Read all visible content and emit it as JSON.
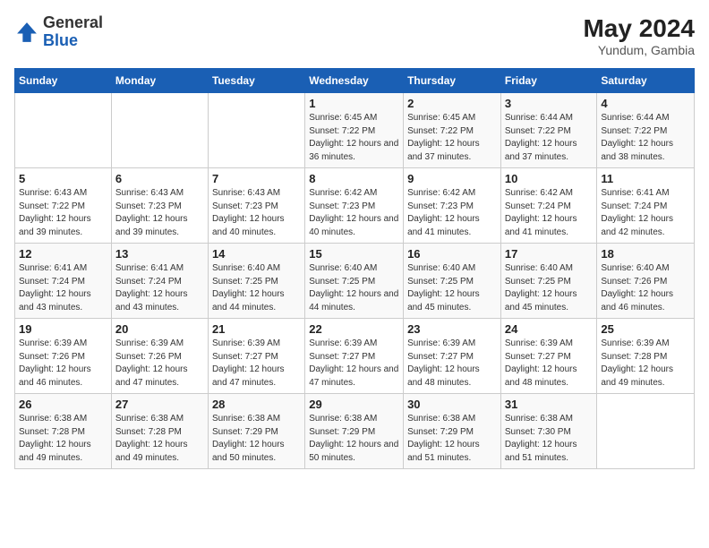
{
  "header": {
    "logo_general": "General",
    "logo_blue": "Blue",
    "month_year": "May 2024",
    "location": "Yundum, Gambia"
  },
  "weekdays": [
    "Sunday",
    "Monday",
    "Tuesday",
    "Wednesday",
    "Thursday",
    "Friday",
    "Saturday"
  ],
  "weeks": [
    [
      {
        "day": "",
        "sunrise": "",
        "sunset": "",
        "daylight": ""
      },
      {
        "day": "",
        "sunrise": "",
        "sunset": "",
        "daylight": ""
      },
      {
        "day": "",
        "sunrise": "",
        "sunset": "",
        "daylight": ""
      },
      {
        "day": "1",
        "sunrise": "Sunrise: 6:45 AM",
        "sunset": "Sunset: 7:22 PM",
        "daylight": "Daylight: 12 hours and 36 minutes."
      },
      {
        "day": "2",
        "sunrise": "Sunrise: 6:45 AM",
        "sunset": "Sunset: 7:22 PM",
        "daylight": "Daylight: 12 hours and 37 minutes."
      },
      {
        "day": "3",
        "sunrise": "Sunrise: 6:44 AM",
        "sunset": "Sunset: 7:22 PM",
        "daylight": "Daylight: 12 hours and 37 minutes."
      },
      {
        "day": "4",
        "sunrise": "Sunrise: 6:44 AM",
        "sunset": "Sunset: 7:22 PM",
        "daylight": "Daylight: 12 hours and 38 minutes."
      }
    ],
    [
      {
        "day": "5",
        "sunrise": "Sunrise: 6:43 AM",
        "sunset": "Sunset: 7:22 PM",
        "daylight": "Daylight: 12 hours and 39 minutes."
      },
      {
        "day": "6",
        "sunrise": "Sunrise: 6:43 AM",
        "sunset": "Sunset: 7:23 PM",
        "daylight": "Daylight: 12 hours and 39 minutes."
      },
      {
        "day": "7",
        "sunrise": "Sunrise: 6:43 AM",
        "sunset": "Sunset: 7:23 PM",
        "daylight": "Daylight: 12 hours and 40 minutes."
      },
      {
        "day": "8",
        "sunrise": "Sunrise: 6:42 AM",
        "sunset": "Sunset: 7:23 PM",
        "daylight": "Daylight: 12 hours and 40 minutes."
      },
      {
        "day": "9",
        "sunrise": "Sunrise: 6:42 AM",
        "sunset": "Sunset: 7:23 PM",
        "daylight": "Daylight: 12 hours and 41 minutes."
      },
      {
        "day": "10",
        "sunrise": "Sunrise: 6:42 AM",
        "sunset": "Sunset: 7:24 PM",
        "daylight": "Daylight: 12 hours and 41 minutes."
      },
      {
        "day": "11",
        "sunrise": "Sunrise: 6:41 AM",
        "sunset": "Sunset: 7:24 PM",
        "daylight": "Daylight: 12 hours and 42 minutes."
      }
    ],
    [
      {
        "day": "12",
        "sunrise": "Sunrise: 6:41 AM",
        "sunset": "Sunset: 7:24 PM",
        "daylight": "Daylight: 12 hours and 43 minutes."
      },
      {
        "day": "13",
        "sunrise": "Sunrise: 6:41 AM",
        "sunset": "Sunset: 7:24 PM",
        "daylight": "Daylight: 12 hours and 43 minutes."
      },
      {
        "day": "14",
        "sunrise": "Sunrise: 6:40 AM",
        "sunset": "Sunset: 7:25 PM",
        "daylight": "Daylight: 12 hours and 44 minutes."
      },
      {
        "day": "15",
        "sunrise": "Sunrise: 6:40 AM",
        "sunset": "Sunset: 7:25 PM",
        "daylight": "Daylight: 12 hours and 44 minutes."
      },
      {
        "day": "16",
        "sunrise": "Sunrise: 6:40 AM",
        "sunset": "Sunset: 7:25 PM",
        "daylight": "Daylight: 12 hours and 45 minutes."
      },
      {
        "day": "17",
        "sunrise": "Sunrise: 6:40 AM",
        "sunset": "Sunset: 7:25 PM",
        "daylight": "Daylight: 12 hours and 45 minutes."
      },
      {
        "day": "18",
        "sunrise": "Sunrise: 6:40 AM",
        "sunset": "Sunset: 7:26 PM",
        "daylight": "Daylight: 12 hours and 46 minutes."
      }
    ],
    [
      {
        "day": "19",
        "sunrise": "Sunrise: 6:39 AM",
        "sunset": "Sunset: 7:26 PM",
        "daylight": "Daylight: 12 hours and 46 minutes."
      },
      {
        "day": "20",
        "sunrise": "Sunrise: 6:39 AM",
        "sunset": "Sunset: 7:26 PM",
        "daylight": "Daylight: 12 hours and 47 minutes."
      },
      {
        "day": "21",
        "sunrise": "Sunrise: 6:39 AM",
        "sunset": "Sunset: 7:27 PM",
        "daylight": "Daylight: 12 hours and 47 minutes."
      },
      {
        "day": "22",
        "sunrise": "Sunrise: 6:39 AM",
        "sunset": "Sunset: 7:27 PM",
        "daylight": "Daylight: 12 hours and 47 minutes."
      },
      {
        "day": "23",
        "sunrise": "Sunrise: 6:39 AM",
        "sunset": "Sunset: 7:27 PM",
        "daylight": "Daylight: 12 hours and 48 minutes."
      },
      {
        "day": "24",
        "sunrise": "Sunrise: 6:39 AM",
        "sunset": "Sunset: 7:27 PM",
        "daylight": "Daylight: 12 hours and 48 minutes."
      },
      {
        "day": "25",
        "sunrise": "Sunrise: 6:39 AM",
        "sunset": "Sunset: 7:28 PM",
        "daylight": "Daylight: 12 hours and 49 minutes."
      }
    ],
    [
      {
        "day": "26",
        "sunrise": "Sunrise: 6:38 AM",
        "sunset": "Sunset: 7:28 PM",
        "daylight": "Daylight: 12 hours and 49 minutes."
      },
      {
        "day": "27",
        "sunrise": "Sunrise: 6:38 AM",
        "sunset": "Sunset: 7:28 PM",
        "daylight": "Daylight: 12 hours and 49 minutes."
      },
      {
        "day": "28",
        "sunrise": "Sunrise: 6:38 AM",
        "sunset": "Sunset: 7:29 PM",
        "daylight": "Daylight: 12 hours and 50 minutes."
      },
      {
        "day": "29",
        "sunrise": "Sunrise: 6:38 AM",
        "sunset": "Sunset: 7:29 PM",
        "daylight": "Daylight: 12 hours and 50 minutes."
      },
      {
        "day": "30",
        "sunrise": "Sunrise: 6:38 AM",
        "sunset": "Sunset: 7:29 PM",
        "daylight": "Daylight: 12 hours and 51 minutes."
      },
      {
        "day": "31",
        "sunrise": "Sunrise: 6:38 AM",
        "sunset": "Sunset: 7:30 PM",
        "daylight": "Daylight: 12 hours and 51 minutes."
      },
      {
        "day": "",
        "sunrise": "",
        "sunset": "",
        "daylight": ""
      }
    ]
  ]
}
